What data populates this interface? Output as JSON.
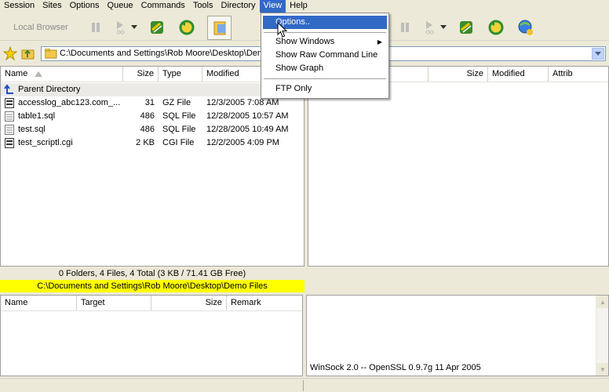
{
  "menubar": {
    "items": [
      "Session",
      "Sites",
      "Options",
      "Queue",
      "Commands",
      "Tools",
      "Directory",
      "View",
      "Help"
    ]
  },
  "toolbar": {
    "local_browser_label": "Local Browser"
  },
  "address": {
    "path": "C:\\Documents and Settings\\Rob Moore\\Desktop\\Demo"
  },
  "local_pane": {
    "columns": [
      "Name",
      "Size",
      "Type",
      "Modified"
    ],
    "rows": [
      {
        "name": "Parent Directory",
        "size": "",
        "type": "",
        "modified": ""
      },
      {
        "name": "accesslog_abc123.com_...",
        "size": "31",
        "type": "GZ File",
        "modified": "12/3/2005 7:08 AM"
      },
      {
        "name": "table1.sql",
        "size": "486",
        "type": "SQL File",
        "modified": "12/28/2005 10:57 AM"
      },
      {
        "name": "test.sql",
        "size": "486",
        "type": "SQL File",
        "modified": "12/28/2005 10:49 AM"
      },
      {
        "name": "test_scriptl.cgi",
        "size": "2 KB",
        "type": "CGI File",
        "modified": "12/2/2005 4:09 PM"
      }
    ],
    "status": "0 Folders, 4 Files, 4 Total (3 KB / 71.41 GB Free)",
    "path_status": "C:\\Documents and Settings\\Rob Moore\\Desktop\\Demo Files"
  },
  "remote_pane": {
    "columns": [
      "Size",
      "Modified",
      "Attrib"
    ]
  },
  "queue_pane": {
    "columns": [
      "Name",
      "Target",
      "Size",
      "Remark"
    ]
  },
  "log_pane": {
    "text": "WinSock 2.0 -- OpenSSL 0.9.7g 11 Apr 2005"
  },
  "view_menu": {
    "items": [
      "Options..",
      "Show Windows",
      "Show Raw Command Line",
      "Show Graph",
      "FTP Only"
    ]
  },
  "colors": {
    "accent": "#316ac5",
    "path_highlight": "#ffff00",
    "chrome": "#ece9d8"
  }
}
